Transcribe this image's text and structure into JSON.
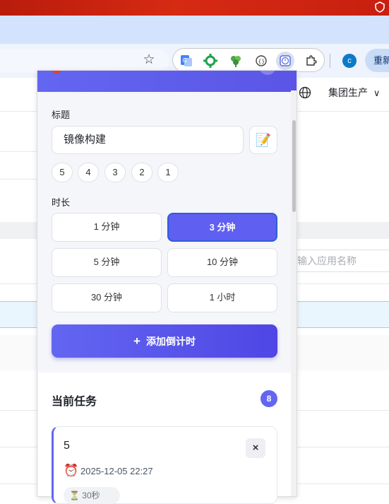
{
  "browser": {
    "profile_initial": "c",
    "refresh_label": "重新",
    "extensions": [
      "translate-icon",
      "green-gear-icon",
      "puzzle-clover-icon",
      "code-braces-icon",
      "timer-extension-icon",
      "extensions-puzzle-icon"
    ]
  },
  "page": {
    "org_selector": "集团生产",
    "app_search_placeholder": "输入应用名称"
  },
  "popup": {
    "title_label": "标题",
    "title_value": "镜像构建",
    "recent_chips": [
      "5",
      "4",
      "3",
      "2",
      "1"
    ],
    "duration_label": "时长",
    "durations": [
      "1 分钟",
      "3 分钟",
      "5 分钟",
      "10 分钟",
      "30 分钟",
      "1 小时"
    ],
    "selected_duration": "3 分钟",
    "add_button": "添加倒计时",
    "tasks_header": "当前任务",
    "task_count": "8",
    "tasks": [
      {
        "name": "5",
        "time": "2025-12-05 22:27",
        "remaining": "30秒"
      }
    ]
  },
  "colors": {
    "accent": "#6366f1",
    "accent_dark": "#4f46e5",
    "chrome_red": "#c81f10",
    "tabstrip": "#d3e3fd"
  }
}
